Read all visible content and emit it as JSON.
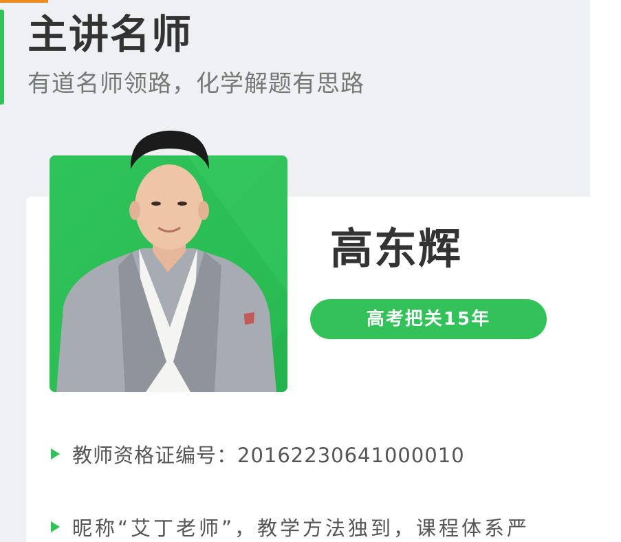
{
  "section": {
    "title": "主讲名师",
    "subtitle": "有道名师领路，化学解题有思路"
  },
  "teacher": {
    "name": "高东辉",
    "badge": "高考把关15年",
    "info": [
      {
        "text": "教师资格证编号：20162230641000010"
      },
      {
        "text": "昵称“艾丁老师”，教学方法独到，课程体系严"
      }
    ]
  },
  "colors": {
    "accent_green": "#33c15a",
    "top_accent_orange": "#f08a1c",
    "panel_bg": "#eef0f3"
  },
  "icons": {
    "bullet": "green-triangle-icon"
  }
}
